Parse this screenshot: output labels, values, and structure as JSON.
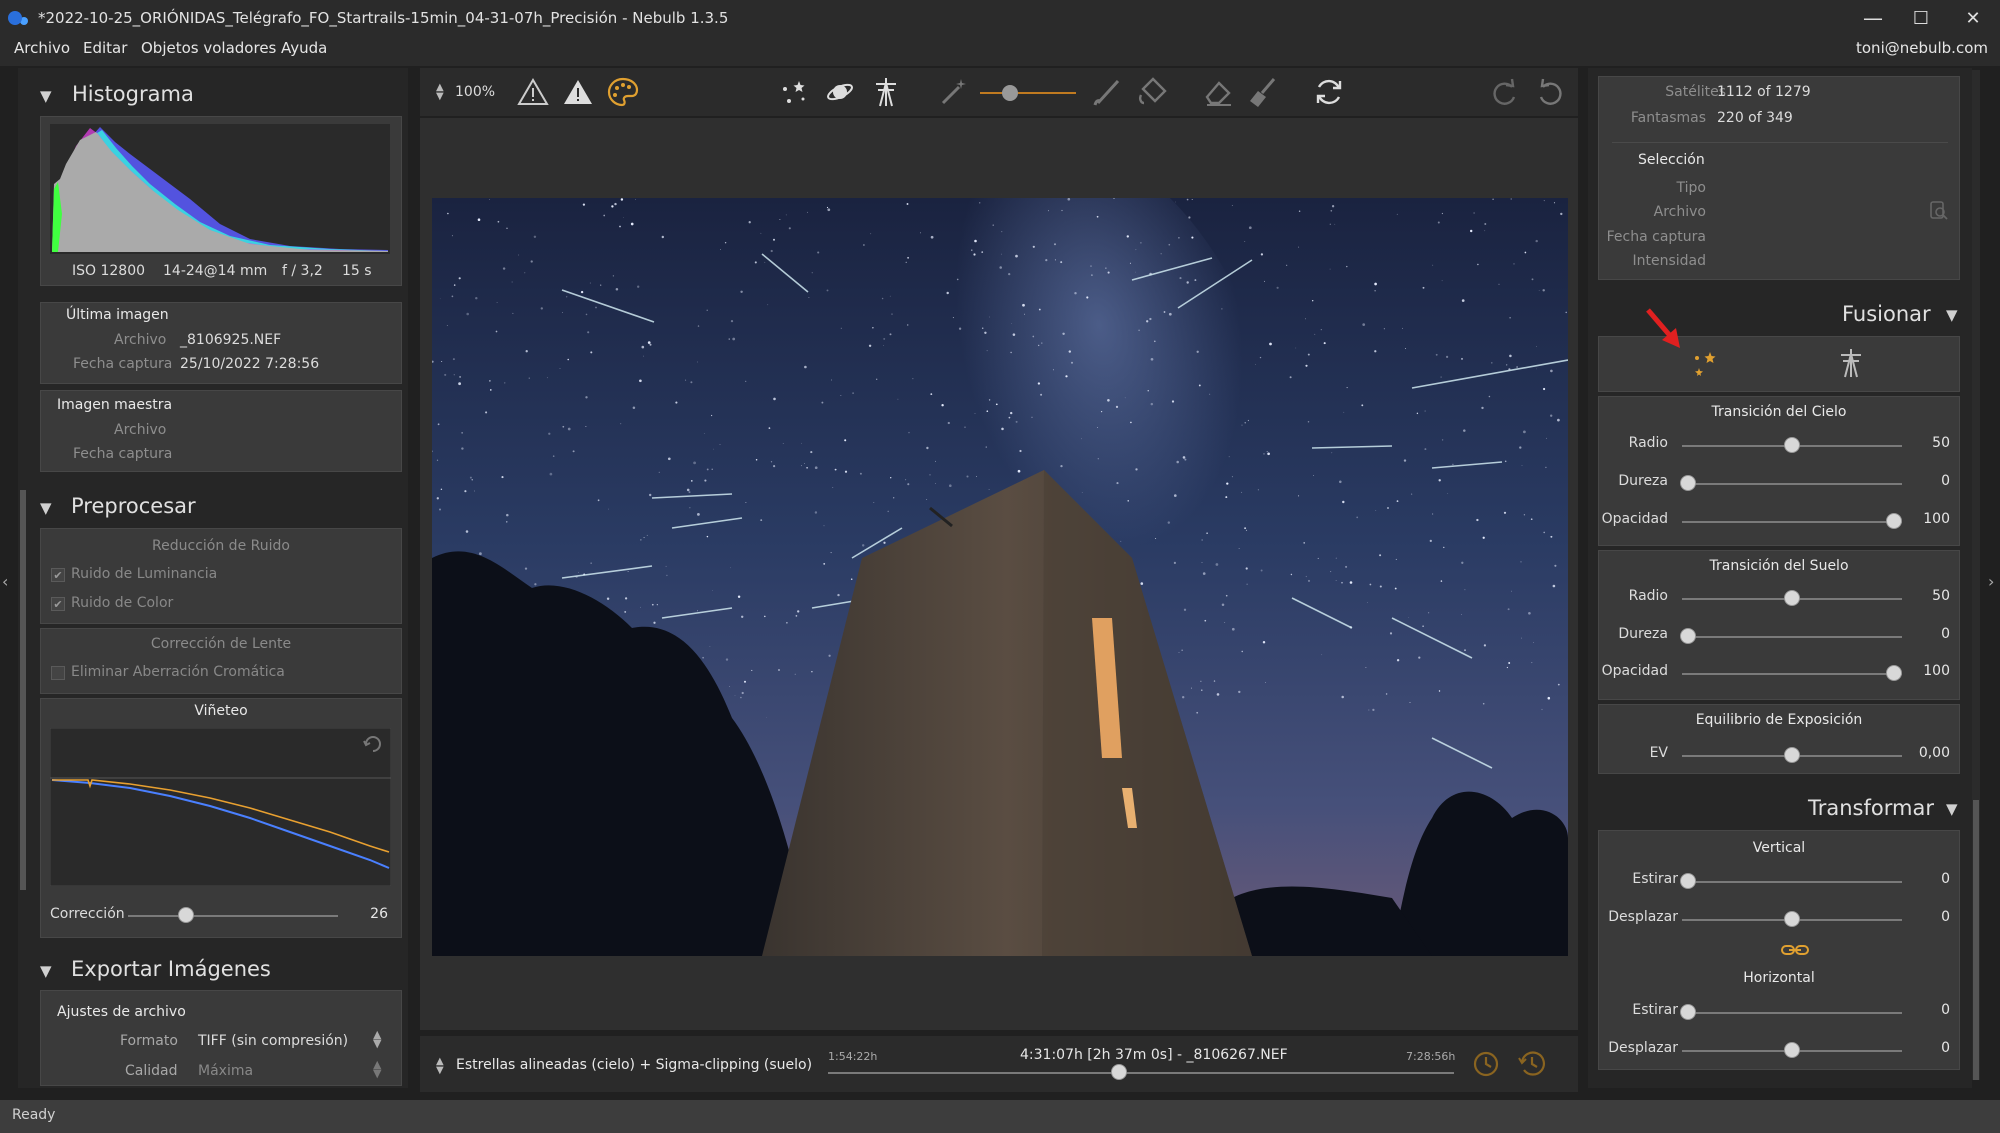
{
  "window": {
    "title": "*2022-10-25_ORIÓNIDAS_Telégrafo_FO_Startrails-15min_04-31-07h_Precisión - Nebulb 1.3.5",
    "minimize": "—",
    "maximize": "☐",
    "close": "✕"
  },
  "menu": {
    "items": [
      "Archivo",
      "Editar",
      "Objetos voladores",
      "Ayuda"
    ],
    "user": "toni@nebulb.com"
  },
  "histogram": {
    "title": "Histograma",
    "iso": "ISO 12800",
    "lens": "14-24@14 mm",
    "aperture": "f / 3,2",
    "exposure": "15 s"
  },
  "last_image": {
    "title": "Última imagen",
    "file_label": "Archivo",
    "file_value": "_8106925.NEF",
    "date_label": "Fecha captura",
    "date_value": "25/10/2022 7:28:56"
  },
  "master_image": {
    "title": "Imagen maestra",
    "file_label": "Archivo",
    "date_label": "Fecha captura"
  },
  "preprocess": {
    "title": "Preprocesar",
    "noise_title": "Reducción de Ruido",
    "luminance": "Ruido de Luminancia",
    "color": "Ruido de Color",
    "lens_title": "Corrección de Lente",
    "chromatic": "Eliminar Aberración Cromática",
    "vignette_title": "Viñeteo",
    "correction_label": "Corrección",
    "correction_value": "26"
  },
  "export": {
    "title": "Exportar Imágenes",
    "file_settings": "Ajustes de archivo",
    "format_label": "Formato",
    "format_value": "TIFF (sin compresión)",
    "quality_label": "Calidad",
    "quality_value": "Máxima"
  },
  "toolbar": {
    "zoom": "100%"
  },
  "timeline": {
    "mode": "Estrellas alineadas (cielo) + Sigma-clipping (suelo)",
    "start": "1:54:22h",
    "current": "4:31:07h [2h 37m 0s] - _8106267.NEF",
    "end": "7:28:56h",
    "position": 0.465
  },
  "info": {
    "satellites_label": "Satélites",
    "satellites_value": "1112 of 1279",
    "ghosts_label": "Fantasmas",
    "ghosts_value": "220 of 349",
    "selection_title": "Selección",
    "type_label": "Tipo",
    "file_label": "Archivo",
    "date_label": "Fecha captura",
    "intensity_label": "Intensidad"
  },
  "merge": {
    "title": "Fusionar",
    "sky_title": "Transición del Cielo",
    "ground_title": "Transición del Suelo",
    "radius_label": "Radio",
    "hardness_label": "Dureza",
    "opacity_label": "Opacidad",
    "sky_radius": "50",
    "sky_hardness": "0",
    "sky_opacity": "100",
    "ground_radius": "50",
    "ground_hardness": "0",
    "ground_opacity": "100",
    "exposure_title": "Equilibrio de Exposición",
    "ev_label": "EV",
    "ev_value": "0,00"
  },
  "transform": {
    "title": "Transformar",
    "vertical_title": "Vertical",
    "horizontal_title": "Horizontal",
    "stretch_label": "Estirar",
    "shift_label": "Desplazar",
    "v_stretch": "0",
    "v_shift": "0",
    "h_stretch": "0",
    "h_shift": "0"
  },
  "status": {
    "text": "Ready"
  },
  "colors": {
    "accent": "#e0a030",
    "arrow": "#e02020"
  }
}
